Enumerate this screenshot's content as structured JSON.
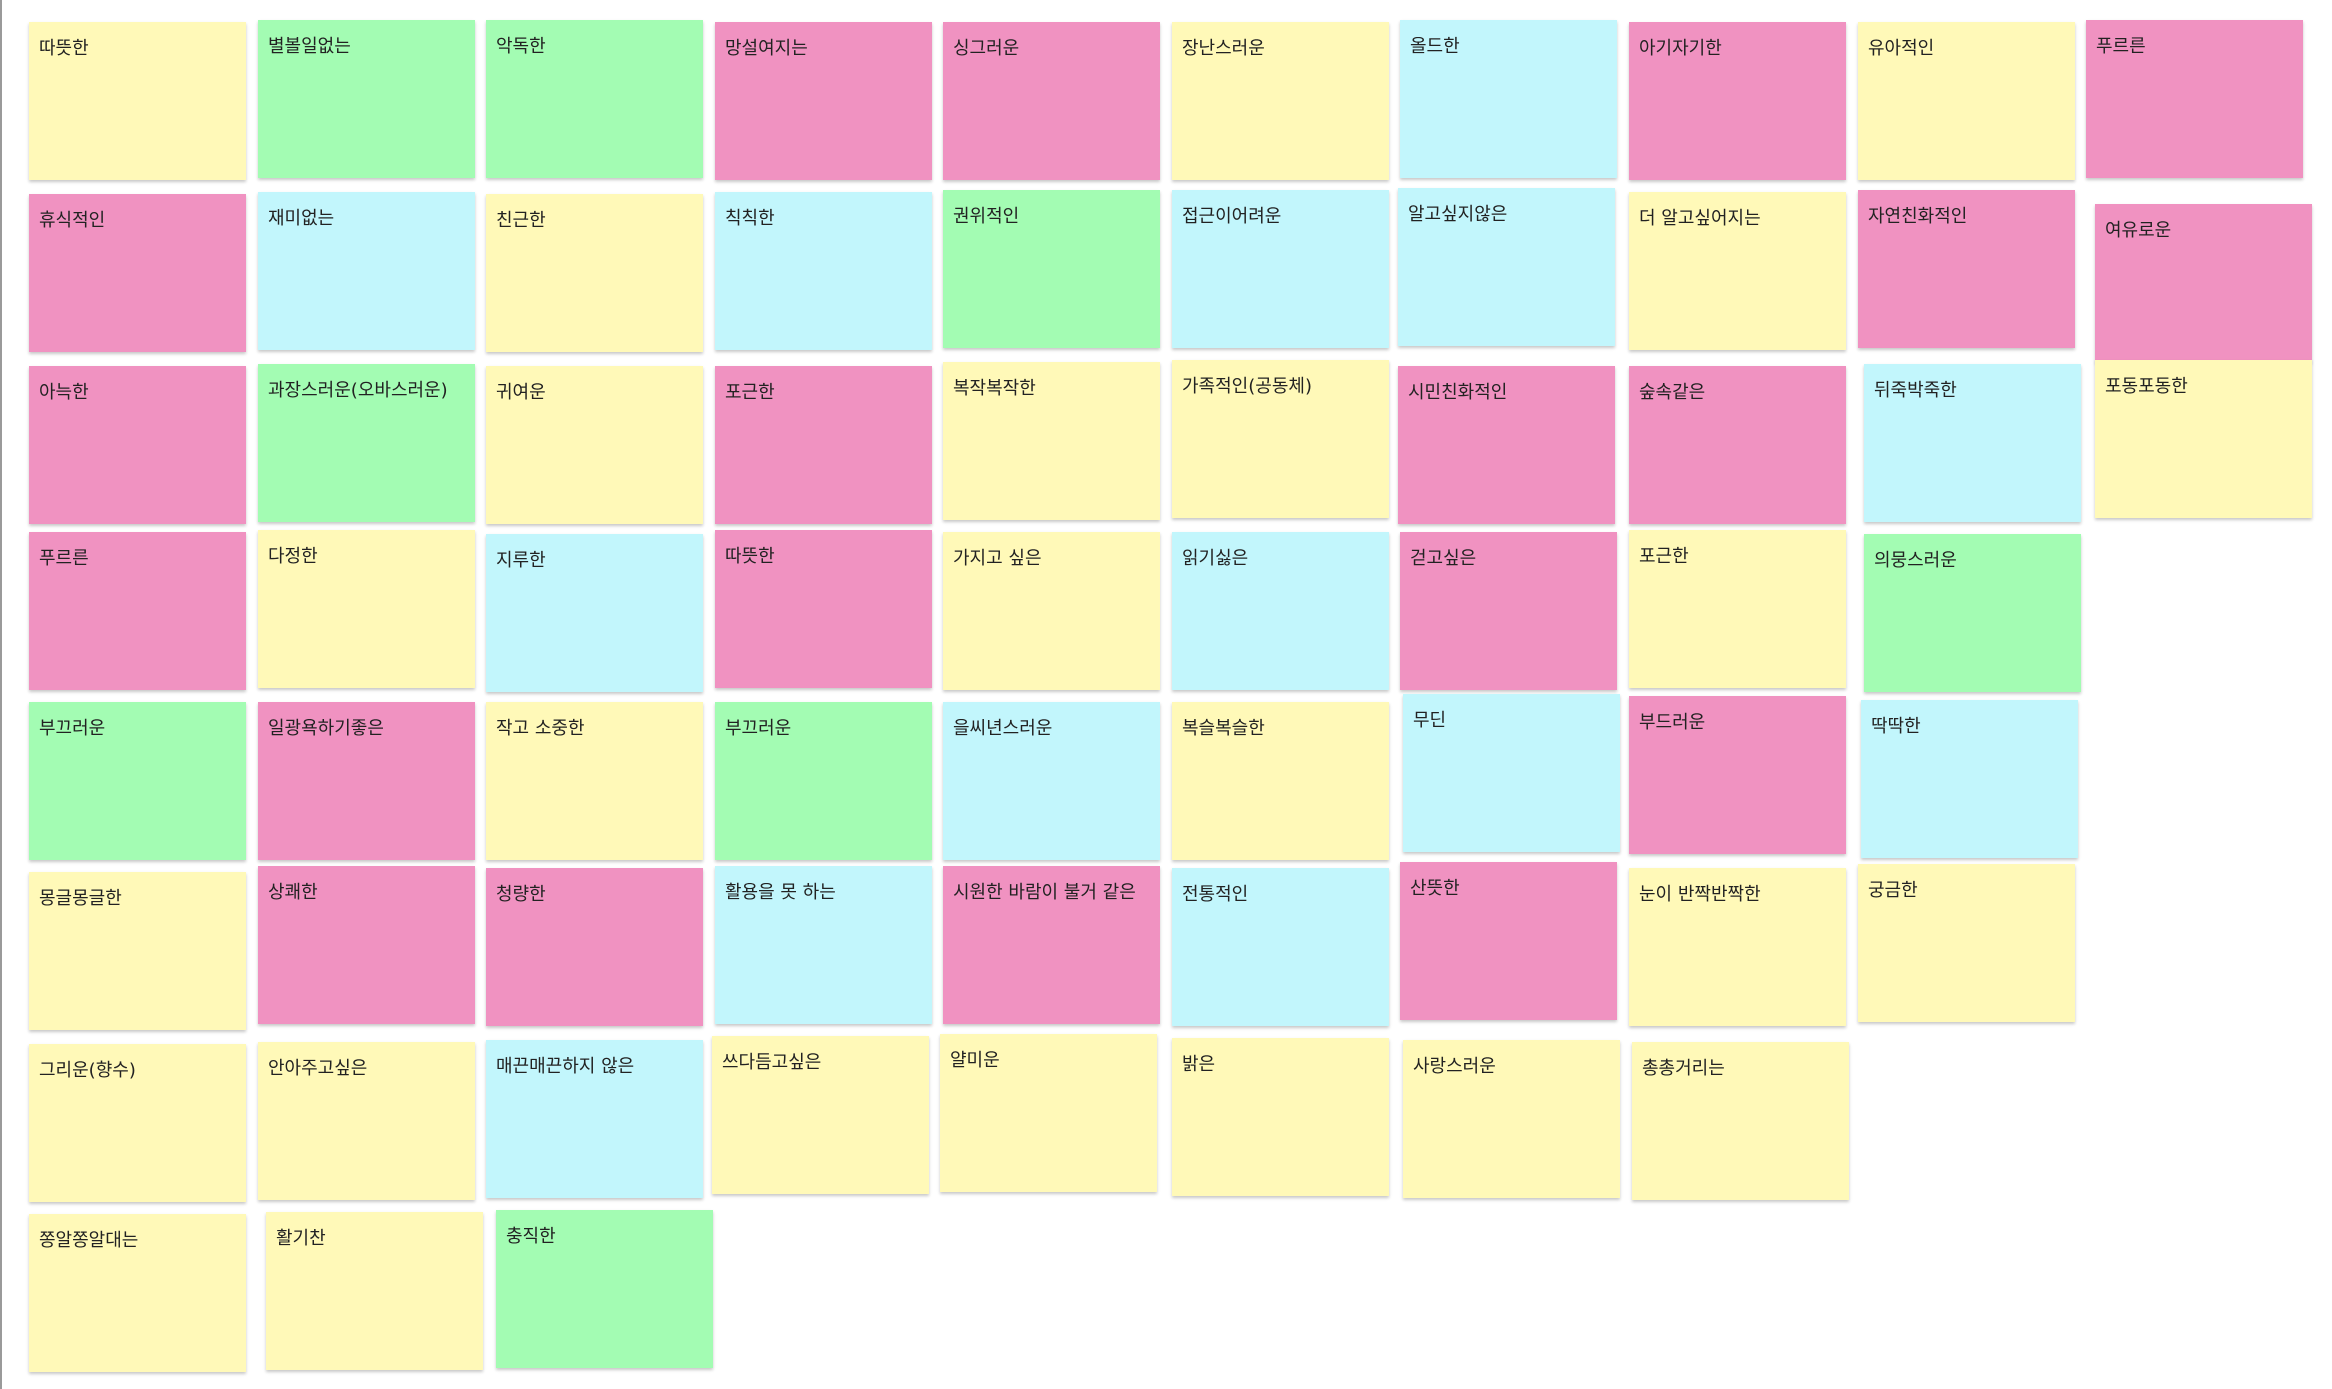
{
  "board": {
    "colors": {
      "yellow": "#fff9b8",
      "green": "#a3fcb3",
      "pink": "#f092c1",
      "cyan": "#c2f6fc"
    },
    "notes": [
      {
        "label": "따뜻한",
        "color": "yellow"
      },
      {
        "label": "별볼일없는",
        "color": "green"
      },
      {
        "label": "악독한",
        "color": "green"
      },
      {
        "label": "망설여지는",
        "color": "pink"
      },
      {
        "label": "싱그러운",
        "color": "pink"
      },
      {
        "label": "장난스러운",
        "color": "yellow"
      },
      {
        "label": "올드한",
        "color": "cyan"
      },
      {
        "label": "아기자기한",
        "color": "pink"
      },
      {
        "label": "유아적인",
        "color": "yellow"
      },
      {
        "label": "푸르른",
        "color": "pink"
      },
      {
        "label": "휴식적인",
        "color": "pink"
      },
      {
        "label": "재미없는",
        "color": "cyan"
      },
      {
        "label": "친근한",
        "color": "yellow"
      },
      {
        "label": "칙칙한",
        "color": "cyan"
      },
      {
        "label": "권위적인",
        "color": "green"
      },
      {
        "label": "접근이어려운",
        "color": "cyan"
      },
      {
        "label": "알고싶지않은",
        "color": "cyan"
      },
      {
        "label": "더 알고싶어지는",
        "color": "yellow"
      },
      {
        "label": "자연친화적인",
        "color": "pink"
      },
      {
        "label": "여유로운",
        "color": "pink"
      },
      {
        "label": "아늑한",
        "color": "pink"
      },
      {
        "label": "과장스러운(오바스러운)",
        "color": "green"
      },
      {
        "label": "귀여운",
        "color": "yellow"
      },
      {
        "label": "포근한",
        "color": "pink"
      },
      {
        "label": "복작복작한",
        "color": "yellow"
      },
      {
        "label": "가족적인(공동체)",
        "color": "yellow"
      },
      {
        "label": "시민친화적인",
        "color": "pink"
      },
      {
        "label": "숲속같은",
        "color": "pink"
      },
      {
        "label": "뒤죽박죽한",
        "color": "cyan"
      },
      {
        "label": "포동포동한",
        "color": "yellow"
      },
      {
        "label": "푸르른",
        "color": "pink"
      },
      {
        "label": "다정한",
        "color": "yellow"
      },
      {
        "label": "지루한",
        "color": "cyan"
      },
      {
        "label": "따뜻한",
        "color": "pink"
      },
      {
        "label": "가지고 싶은",
        "color": "yellow"
      },
      {
        "label": "읽기싫은",
        "color": "cyan"
      },
      {
        "label": "걷고싶은",
        "color": "pink"
      },
      {
        "label": "포근한",
        "color": "yellow"
      },
      {
        "label": "의뭉스러운",
        "color": "green"
      },
      {
        "label": "부끄러운",
        "color": "green"
      },
      {
        "label": "일광욕하기좋은",
        "color": "pink"
      },
      {
        "label": "작고 소중한",
        "color": "yellow"
      },
      {
        "label": "부끄러운",
        "color": "green"
      },
      {
        "label": "을씨년스러운",
        "color": "cyan"
      },
      {
        "label": "복슬복슬한",
        "color": "yellow"
      },
      {
        "label": "무딘",
        "color": "cyan"
      },
      {
        "label": "부드러운",
        "color": "pink"
      },
      {
        "label": "딱딱한",
        "color": "cyan"
      },
      {
        "label": "몽글몽글한",
        "color": "yellow"
      },
      {
        "label": "상쾌한",
        "color": "pink"
      },
      {
        "label": "청량한",
        "color": "pink"
      },
      {
        "label": "활용을 못 하는",
        "color": "cyan"
      },
      {
        "label": "시원한 바람이 불거 같은",
        "color": "pink"
      },
      {
        "label": "전통적인",
        "color": "cyan"
      },
      {
        "label": "산뜻한",
        "color": "pink"
      },
      {
        "label": "눈이 반짝반짝한",
        "color": "yellow"
      },
      {
        "label": "궁금한",
        "color": "yellow"
      },
      {
        "label": "그리운(향수)",
        "color": "yellow"
      },
      {
        "label": "안아주고싶은",
        "color": "yellow"
      },
      {
        "label": "매끈매끈하지 않은",
        "color": "cyan"
      },
      {
        "label": "쓰다듬고싶은",
        "color": "yellow"
      },
      {
        "label": "얄미운",
        "color": "yellow"
      },
      {
        "label": "밝은",
        "color": "yellow"
      },
      {
        "label": "사랑스러운",
        "color": "yellow"
      },
      {
        "label": "총총거리는",
        "color": "yellow"
      },
      {
        "label": "쫑알쫑알대는",
        "color": "yellow"
      },
      {
        "label": "활기찬",
        "color": "yellow"
      },
      {
        "label": "충직한",
        "color": "green"
      }
    ]
  }
}
